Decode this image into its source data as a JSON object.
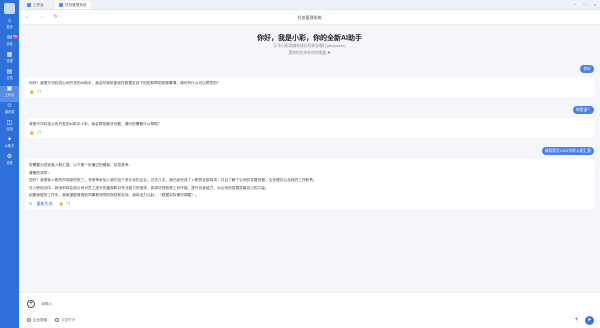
{
  "sidebar": {
    "items": [
      {
        "label": "首页",
        "icon": "home-icon"
      },
      {
        "label": "消息",
        "icon": "message-icon",
        "badge": "99+"
      },
      {
        "label": "日程",
        "icon": "calendar-icon"
      },
      {
        "label": "文档",
        "icon": "document-icon"
      },
      {
        "label": "工作台",
        "icon": "workbench-icon"
      },
      {
        "label": "通讯录",
        "icon": "contacts-icon"
      },
      {
        "label": "应用",
        "icon": "apps-icon"
      },
      {
        "label": "AI助手",
        "icon": "ai-icon"
      },
      {
        "label": "设置",
        "icon": "settings-icon"
      }
    ]
  },
  "tabs": [
    {
      "label": "工作台"
    },
    {
      "label": "任务管理系统"
    }
  ],
  "nav": {
    "title": "任务管理系统"
  },
  "welcome": {
    "title": "你好，我是小彩，你的全新AI助手",
    "line1": "乐华小彩伴随你成长问你去哪儿(deepseek)",
    "line2": "是你的任何伙伴你需要 ❤"
  },
  "messages": {
    "u1": "你好",
    "a1": "你好！我是乐华科技公司开发的AI助手，我会尽我所能地在数据支持下回答和帮助您做事情，请问有什么可以帮您的？",
    "u2": "你是谁？",
    "a2": "我是乐华科技公司开发的AI助手小彩，我会帮您解决问题，请问您需要什么帮助？",
    "u3": "请帮我写1000字的入职汇报",
    "a3_lines": [
      "您需要为您准备入职汇报。以下是一份通过的模板，供您参考：",
      "尊敬的领导：",
      "您好！我是新入职的市场部的张三，非常荣幸加入我们这个多元化的企业。过去几天，我已经完成了入职的全部培训，并且了解了公司的发展历程、文化理念以及我的工作职责。",
      "在入职培训中，我深刻体会到公司对员工成长的重视和对专业能力的追求。我将尽快熟悉工作环境，提升自身能力，为公司的发展贡献自己的力量。",
      "如果我做的工作中，我希望能够得到同事和领导的指导和支持。我将全力以赴，（根据实际情况调整）。"
    ],
    "regenerate": "重新生成"
  },
  "input": {
    "placeholder": "请输入",
    "tool1": "企业搜索",
    "tool2": "深度思考"
  },
  "colors": {
    "accent": "#2f6fd9",
    "user_bubble": "#4c7fe8",
    "background": "#f4f6fa"
  }
}
